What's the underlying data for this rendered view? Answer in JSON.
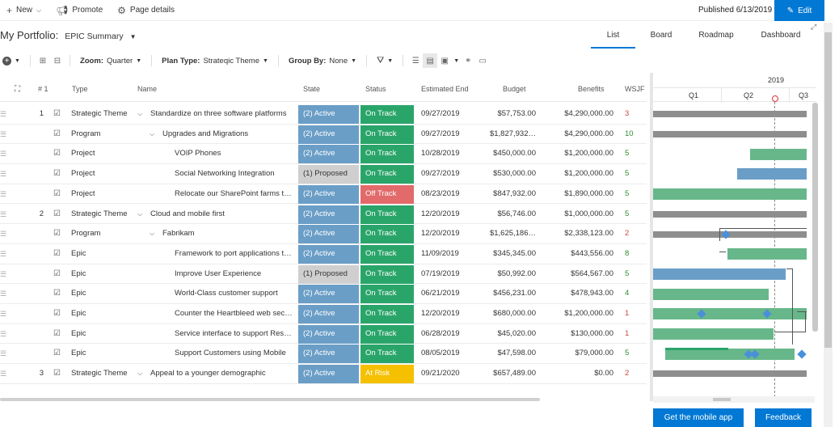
{
  "command_bar": {
    "new_label": "New",
    "promote_label": "Promote",
    "page_details_label": "Page details",
    "published": "Published 6/13/2019",
    "edit_label": "Edit"
  },
  "title": {
    "portfolio": "My Portfolio:",
    "summary": "EPIC Summary"
  },
  "views": [
    "List",
    "Board",
    "Roadmap",
    "Dashboard"
  ],
  "toolbar": {
    "zoom_label": "Zoom:",
    "zoom_value": "Quarter",
    "plan_label": "Plan Type:",
    "plan_value": "Strateqic Theme",
    "group_label": "Group By:",
    "group_value": "None"
  },
  "columns": {
    "num": "# 1",
    "type": "Type",
    "name": "Name",
    "state": "State",
    "status": "Status",
    "end": "Estimated End",
    "budget": "Budget",
    "benefits": "Benefits",
    "wsjf": "WSJF"
  },
  "timeline": {
    "year": "2019",
    "q1": "Q1",
    "q2": "Q2",
    "q3": "Q3"
  },
  "rows": [
    {
      "num": "1",
      "type": "Strategic Theme",
      "name": "Standardize on three software platforms",
      "state": "(2) Active",
      "status": "On Track",
      "end": "09/27/2019",
      "budget": "$57,753.00",
      "benefits": "$4,290,000.00",
      "wsjf": "3"
    },
    {
      "num": "",
      "type": "Program",
      "name": "Upgrades and Migrations",
      "state": "(2) Active",
      "status": "On Track",
      "end": "09/27/2019",
      "budget": "$1,827,932…",
      "benefits": "$4,290,000.00",
      "wsjf": "10"
    },
    {
      "num": "",
      "type": "Project",
      "name": "VOIP Phones",
      "state": "(2) Active",
      "status": "On Track",
      "end": "10/28/2019",
      "budget": "$450,000.00",
      "benefits": "$1,200,000.00",
      "wsjf": "5"
    },
    {
      "num": "",
      "type": "Project",
      "name": "Social Networking Integration",
      "state": "(1) Proposed",
      "status": "On Track",
      "end": "09/27/2019",
      "budget": "$530,000.00",
      "benefits": "$1,200,000.00",
      "wsjf": "5"
    },
    {
      "num": "",
      "type": "Project",
      "name": "Relocate our SharePoint farms to…",
      "state": "(2) Active",
      "status": "Off Track",
      "end": "08/23/2019",
      "budget": "$847,932.00",
      "benefits": "$1,890,000.00",
      "wsjf": "5"
    },
    {
      "num": "2",
      "type": "Strategic Theme",
      "name": "Cloud and mobile first",
      "state": "(2) Active",
      "status": "On Track",
      "end": "12/20/2019",
      "budget": "$56,746.00",
      "benefits": "$1,000,000.00",
      "wsjf": "5"
    },
    {
      "num": "",
      "type": "Program",
      "name": "Fabrikam",
      "state": "(2) Active",
      "status": "On Track",
      "end": "12/20/2019",
      "budget": "$1,625,186…",
      "benefits": "$2,338,123.00",
      "wsjf": "2"
    },
    {
      "num": "",
      "type": "Epic",
      "name": "Framework to port applications t…",
      "state": "(2) Active",
      "status": "On Track",
      "end": "11/09/2019",
      "budget": "$345,345.00",
      "benefits": "$443,556.00",
      "wsjf": "8"
    },
    {
      "num": "",
      "type": "Epic",
      "name": "Improve User Experience",
      "state": "(1) Proposed",
      "status": "On Track",
      "end": "07/19/2019",
      "budget": "$50,992.00",
      "benefits": "$564,567.00",
      "wsjf": "5"
    },
    {
      "num": "",
      "type": "Epic",
      "name": "World-Class customer support",
      "state": "(2) Active",
      "status": "On Track",
      "end": "06/21/2019",
      "budget": "$456,231.00",
      "benefits": "$478,943.00",
      "wsjf": "4"
    },
    {
      "num": "",
      "type": "Epic",
      "name": "Counter the Heartbleed web sec…",
      "state": "(2) Active",
      "status": "On Track",
      "end": "12/20/2019",
      "budget": "$680,000.00",
      "benefits": "$1,200,000.00",
      "wsjf": "1"
    },
    {
      "num": "",
      "type": "Epic",
      "name": "Service interface to support Rest…",
      "state": "(2) Active",
      "status": "On Track",
      "end": "06/28/2019",
      "budget": "$45,020.00",
      "benefits": "$130,000.00",
      "wsjf": "1"
    },
    {
      "num": "",
      "type": "Epic",
      "name": "Support Customers using Mobile",
      "state": "(2) Active",
      "status": "On Track",
      "end": "08/05/2019",
      "budget": "$47,598.00",
      "benefits": "$79,000.00",
      "wsjf": "5"
    },
    {
      "num": "3",
      "type": "Strategic Theme",
      "name": "Appeal to a younger demographic",
      "state": "(2) Active",
      "status": "At Risk",
      "end": "09/21/2020",
      "budget": "$657,489.00",
      "benefits": "$0.00",
      "wsjf": "2"
    }
  ],
  "footer": {
    "mobile_label": "Get the mobile app",
    "feedback_label": "Feedback"
  },
  "colors": {
    "accent": "#0078d4",
    "active": "#6a9ec7",
    "proposed": "#cfcfcf",
    "on_track": "#2aa56a",
    "off_track": "#e36a6a",
    "at_risk": "#f5c000",
    "bar_green": "#67b78a",
    "bar_blue": "#6a9ec7",
    "bar_gray": "#8e8e8e"
  }
}
